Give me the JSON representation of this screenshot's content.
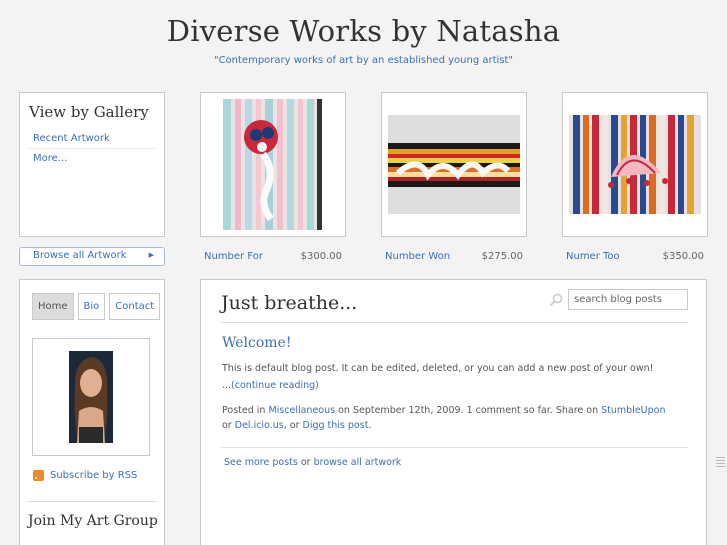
{
  "site": {
    "title": "Diverse Works by Natasha",
    "tagline": "\"Contemporary works of art by an established young artist\""
  },
  "gallery": {
    "heading": "View by Gallery",
    "items": [
      "Recent Artwork",
      "More..."
    ],
    "browse_all": "Browse all Artwork"
  },
  "artworks": [
    {
      "title": "Number For",
      "price": "$300.00"
    },
    {
      "title": "Number Won",
      "price": "$275.00"
    },
    {
      "title": "Numer Too",
      "price": "$350.00"
    }
  ],
  "nav": {
    "tabs": [
      "Home",
      "Bio",
      "Contact"
    ],
    "rss": "Subscribe by RSS",
    "join": "Join My Art Group"
  },
  "blog": {
    "heading": "Just breathe...",
    "search_placeholder": "search blog posts",
    "post": {
      "title": "Welcome!",
      "body": "This is default blog post. It can be edited, deleted, or you can add a new post of your own!",
      "continue": "...(continue reading)",
      "meta_posted_in": "Posted in",
      "meta_category": "Miscellaneous",
      "meta_date": "on September 12th, 2009. 1 comment so far. Share on",
      "meta_share1": "StumbleUpon",
      "meta_or1": "or",
      "meta_share2": "Del.icio.us",
      "meta_or2": ", or",
      "meta_share3": "Digg this post",
      "meta_end": "."
    },
    "footer_link1": "See more posts",
    "footer_or": "or",
    "footer_link2": "browse all artwork"
  },
  "colors": {
    "link": "#3b6fb6",
    "background": "#f3f3f3",
    "panel_border": "#c9c9c9",
    "rss": "#f08a24"
  }
}
